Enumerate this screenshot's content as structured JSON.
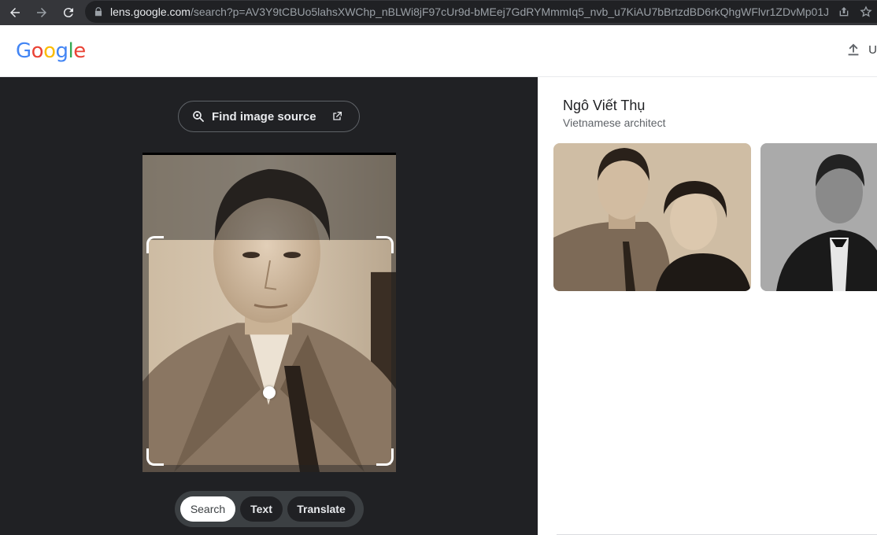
{
  "browser": {
    "url_host": "lens.google.com",
    "url_path": "/search?p=AV3Y9tCBUo5lahsXWChp_nBLWi8jF97cUr9d-bMEej7GdRYMmmIq5_nvb_u7KiAU7bBrtzdBD6rkQhgWFlvr1ZDvMp01JRCa..."
  },
  "header": {
    "logo": [
      "G",
      "o",
      "o",
      "g",
      "l",
      "e"
    ],
    "upload_label": "U"
  },
  "left_panel": {
    "find_source_label": "Find image source",
    "modes": [
      {
        "label": "Search",
        "active": true
      },
      {
        "label": "Text",
        "active": false
      },
      {
        "label": "Translate",
        "active": false
      }
    ]
  },
  "results": {
    "title": "Ngô Viết Thụ",
    "subtitle": "Vietnamese architect"
  },
  "colors": {
    "google_blue": "#4285F4",
    "google_red": "#EA4335",
    "google_yellow": "#FBBC05",
    "google_green": "#34A853",
    "dark_bg": "#202124"
  }
}
